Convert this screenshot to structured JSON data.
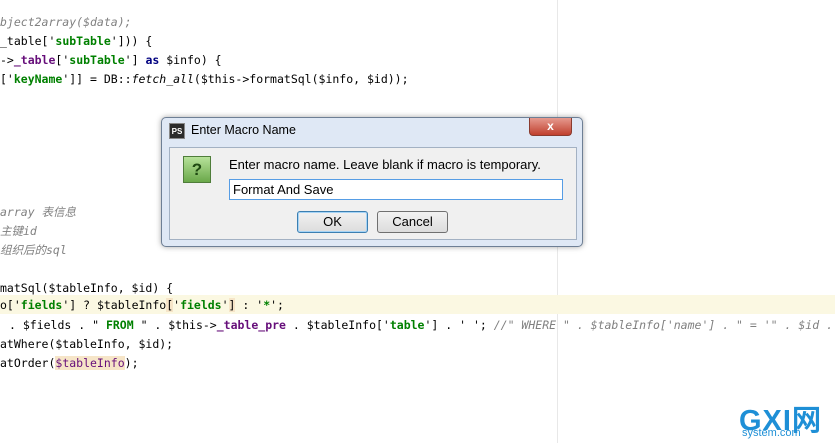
{
  "dialog": {
    "app_icon": "PS",
    "title": "Enter Macro Name",
    "close_glyph": "x",
    "question_icon": "?",
    "prompt": "Enter macro name. Leave blank if macro is temporary.",
    "input_value": "Format And Save",
    "ok_label": "OK",
    "cancel_label": "Cancel"
  },
  "code": {
    "l1": [
      "bject2array($data);"
    ],
    "l2": [
      "_table['",
      "subTable",
      "'])) {"
    ],
    "l3": [
      "->",
      "_table",
      "['",
      "subTable",
      "'] ",
      "as",
      " $info) {"
    ],
    "l4": [
      "['",
      "keyName",
      "']] = DB::",
      "fetch_all",
      "($this->formatSql($info, $id));"
    ],
    "l5": [
      "array 表信息"
    ],
    "l6": [
      "主键",
      "id"
    ],
    "l7": [
      "组织后的",
      "sql"
    ],
    "l8": [
      "matSql($tableInfo, $id) {"
    ],
    "l9": [
      "o['",
      "fields",
      "'] ? $tableInfo",
      "[",
      "'",
      "fields",
      "'",
      "]",
      " : '",
      "*",
      "';"
    ],
    "l10": [
      ". $fields . \"",
      " FROM ",
      "\" . $this->",
      "_table_pre",
      " . $tableInfo['",
      "table",
      "'] . '",
      " ",
      "'; ",
      "//\" WHERE \" . $tableInfo['name'] . \" = '\" . $id . \"'\";"
    ],
    "l11": [
      "atWhere($tableInfo, $id);"
    ],
    "l12": [
      "atOrder(",
      "$tableInfo",
      ");"
    ]
  },
  "watermark": {
    "big": "GXI网",
    "small": "system.com"
  }
}
